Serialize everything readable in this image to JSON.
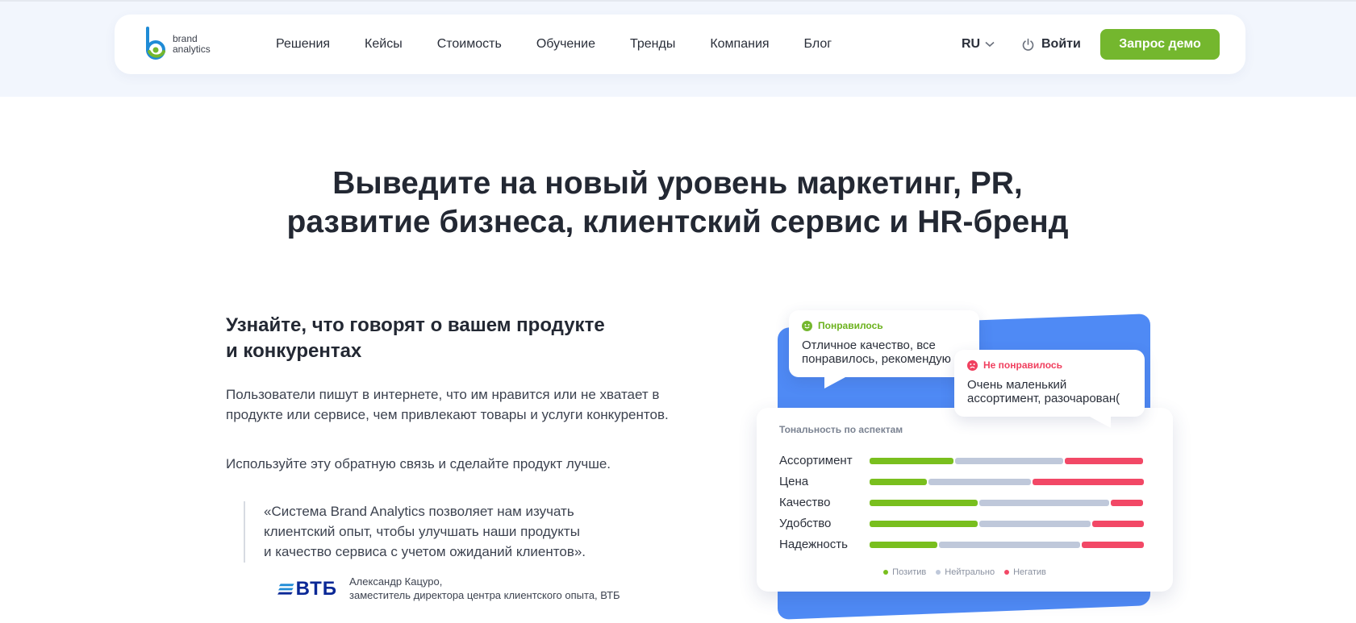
{
  "header": {
    "logo_line1": "brand",
    "logo_line2": "analytics",
    "nav": [
      {
        "label": "Решения"
      },
      {
        "label": "Кейсы"
      },
      {
        "label": "Стоимость"
      },
      {
        "label": "Обучение"
      },
      {
        "label": "Тренды"
      },
      {
        "label": "Компания"
      },
      {
        "label": "Блог"
      }
    ],
    "lang": "RU",
    "login": "Войти",
    "cta": "Запрос демо"
  },
  "hero": {
    "title_line1": "Выведите на новый уровень маркетинг, PR,",
    "title_line2": "развитие бизнеса, клиентский сервис и HR-бренд"
  },
  "section": {
    "title_line1": "Узнайте, что говорят о вашем продукте",
    "title_line2": "и конкурентах",
    "paragraph1": "Пользователи пишут в интернете, что им нравится или не хватает в продукте или сервисе, чем привлекают товары и услуги конкурентов.",
    "paragraph2": "Используйте эту обратную связь и сделайте продукт лучше.",
    "quote_line1": "«Система Brand Analytics позволяет нам изучать",
    "quote_line2": "клиентский опыт, чтобы улучшать наши продукты",
    "quote_line3": "и качество сервиса с учетом ожиданий клиентов».",
    "vtb_logo_text": "ВТБ",
    "author_name": "Александр Кацуро,",
    "author_position": "заместитель директора центра клиентского опыта, ВТБ"
  },
  "bubbles": {
    "like_label": "Понравилось",
    "like_text": "Отличное качество, все понравилось, рекомендую",
    "dislike_label": "Не понравилось",
    "dislike_text": "Очень маленький ассортимент, разочарован("
  },
  "aspects": {
    "title": "Тональность по аспектам",
    "legend": {
      "positive": "Позитив",
      "neutral": "Нейтрально",
      "negative": "Негатив"
    },
    "rows": [
      {
        "label": "Ассортимент",
        "positive": 31,
        "neutral": 40,
        "negative": 29
      },
      {
        "label": "Цена",
        "positive": 21,
        "neutral": 38,
        "negative": 41
      },
      {
        "label": "Качество",
        "positive": 40,
        "neutral": 48,
        "negative": 12
      },
      {
        "label": "Удобство",
        "positive": 40,
        "neutral": 41,
        "negative": 19
      },
      {
        "label": "Надежность",
        "positive": 25,
        "neutral": 52,
        "negative": 23
      }
    ]
  },
  "colors": {
    "accent": "#74b72e",
    "positive": "#79bf1e",
    "neutral": "#bfc8da",
    "negative": "#f24866",
    "card_blue": "#4f8af5"
  }
}
